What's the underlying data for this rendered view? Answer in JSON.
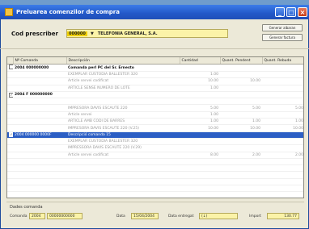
{
  "window": {
    "title": "Preluarea comenzilor de compra"
  },
  "header": {
    "cod_label": "Cod prescriber",
    "cod_code": "000000",
    "cod_name": "TELEFONIA GENERAL, S.A.",
    "btn_1": "Generar albaran",
    "btn_2": "Generar factura"
  },
  "table": {
    "columns": [
      "",
      "Nº Comanda",
      "Descripción",
      "Cantidad",
      "Quant. Pendent",
      "Quant. Rebuda"
    ],
    "rows": [
      {
        "check": false,
        "bold": true,
        "sel": false,
        "num": "2004 000000000",
        "desc": "Comanda perl PC del Sr. Ernesto",
        "qty": "",
        "pend": "",
        "rec": ""
      },
      {
        "check": false,
        "bold": false,
        "sel": false,
        "num": "",
        "desc": "EXEMPLAR CUSTODIA BALLESTER 320",
        "qty": "1.00",
        "pend": "",
        "rec": ""
      },
      {
        "check": false,
        "bold": false,
        "sel": false,
        "num": "",
        "desc": "Article servei codificat",
        "qty": "10.00",
        "pend": "10.00",
        "rec": ""
      },
      {
        "check": false,
        "bold": false,
        "sel": false,
        "num": "",
        "desc": "ARTICLE SENSE NUMERO DE LOTE",
        "qty": "1.00",
        "pend": "",
        "rec": ""
      },
      {
        "check": true,
        "bold": true,
        "sel": false,
        "num": "2004 F 000000000",
        "desc": "",
        "qty": "",
        "pend": "",
        "rec": ""
      },
      {
        "check": false,
        "bold": false,
        "sel": false,
        "num": "",
        "desc": "",
        "qty": "",
        "pend": "",
        "rec": ""
      },
      {
        "check": false,
        "bold": false,
        "sel": false,
        "num": "",
        "desc": "IMPRESORA DAVIS ESCAUTE 220",
        "qty": "5.00",
        "pend": "5.00",
        "rec": "5.00"
      },
      {
        "check": false,
        "bold": false,
        "sel": false,
        "num": "",
        "desc": "Article servei",
        "qty": "1.00",
        "pend": "",
        "rec": ""
      },
      {
        "check": false,
        "bold": false,
        "sel": false,
        "num": "",
        "desc": "ARTICLE AMB CODI DE BARRES",
        "qty": "1.00",
        "pend": "1.00",
        "rec": "1.00"
      },
      {
        "check": false,
        "bold": false,
        "sel": false,
        "num": "",
        "desc": "IMPRESORA DAVIS ESCAUTE 220 (V.25)",
        "qty": "10.00",
        "pend": "10.00",
        "rec": "10.00"
      },
      {
        "check": true,
        "bold": false,
        "sel": true,
        "num": "2004 000000 0000F",
        "desc": "Descripció comanda 15",
        "qty": "",
        "pend": "",
        "rec": ""
      },
      {
        "check": false,
        "bold": false,
        "sel": false,
        "num": "",
        "desc": "EXEMPLAR CUSTODIA BALLESTER 320",
        "qty": "",
        "pend": "",
        "rec": ""
      },
      {
        "check": false,
        "bold": false,
        "sel": false,
        "num": "",
        "desc": "IMPRESSORA DAVIS ESCAUTE 220 (V.29)",
        "qty": "",
        "pend": "",
        "rec": ""
      },
      {
        "check": false,
        "bold": false,
        "sel": false,
        "num": "",
        "desc": "Article servei codificat",
        "qty": "8.00",
        "pend": "2.00",
        "rec": "2.00"
      }
    ]
  },
  "footer": {
    "title": "Dades comanda",
    "comanda_label": "Comanda",
    "comanda_year": "2004",
    "comanda_num": "00000000000",
    "data_label": "Data",
    "data_val": "15/04/2004",
    "data_entrega_label": "Data entregat",
    "data_entrega_val": "(↓)",
    "import_label": "Import",
    "import_val": "130.77"
  }
}
